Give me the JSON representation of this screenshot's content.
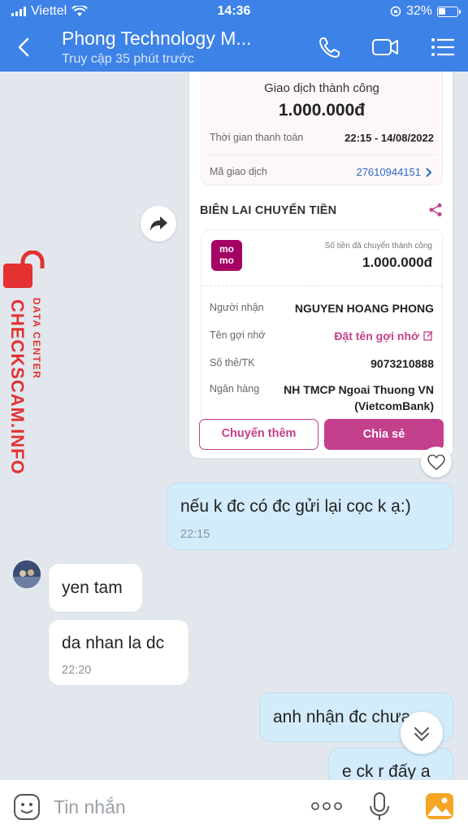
{
  "status_bar": {
    "carrier": "Viettel",
    "time": "14:36",
    "battery": "32%"
  },
  "header": {
    "title": "Phong Technology M...",
    "subtitle": "Truy cập 35 phút trước"
  },
  "receipt": {
    "status": "Giao dịch thành công",
    "amount": "1.000.000đ",
    "payment_time_label": "Thời gian thanh toán",
    "payment_time": "22:15 - 14/08/2022",
    "txn_id_label": "Mã giao dịch",
    "txn_id": "27610944151",
    "heading": "BIÊN LAI CHUYỂN TIỀN",
    "sent_label": "Số tiền đã chuyển thành công",
    "sent_amount": "1.000.000đ",
    "recipient_label": "Người nhận",
    "recipient": "NGUYEN HOANG PHONG",
    "nickname_label": "Tên gợi nhớ",
    "nickname_action": "Đặt tên gợi nhớ",
    "account_label": "Số thẻ/TK",
    "account": "9073210888",
    "bank_label": "Ngân hàng",
    "bank_line1": "NH TMCP Ngoai Thuong VN",
    "bank_line2": "(VietcomBank)",
    "btn_more": "Chuyển thêm",
    "btn_share": "Chia sẻ",
    "logo_text1": "mo",
    "logo_text2": "mo"
  },
  "watermark": {
    "brand": "CHECKSCAM.INFO",
    "sub": "DATA CENTER"
  },
  "messages": [
    {
      "direction": "out",
      "text": "nếu k đc có đc gửi lại cọc k ạ:)",
      "time": "22:15"
    },
    {
      "direction": "in",
      "text": "yen tam"
    },
    {
      "direction": "in",
      "text": "da nhan la dc",
      "time": "22:20"
    },
    {
      "direction": "out",
      "text": "anh nhận đc chưa"
    },
    {
      "direction": "out",
      "text": "e ck r đấy a"
    }
  ],
  "composer": {
    "placeholder": "Tin nhắn"
  },
  "colors": {
    "header": "#3d82e6",
    "momo": "#a50064",
    "accent_pink": "#c43f8c",
    "out_bubble": "#d3ecfb"
  }
}
